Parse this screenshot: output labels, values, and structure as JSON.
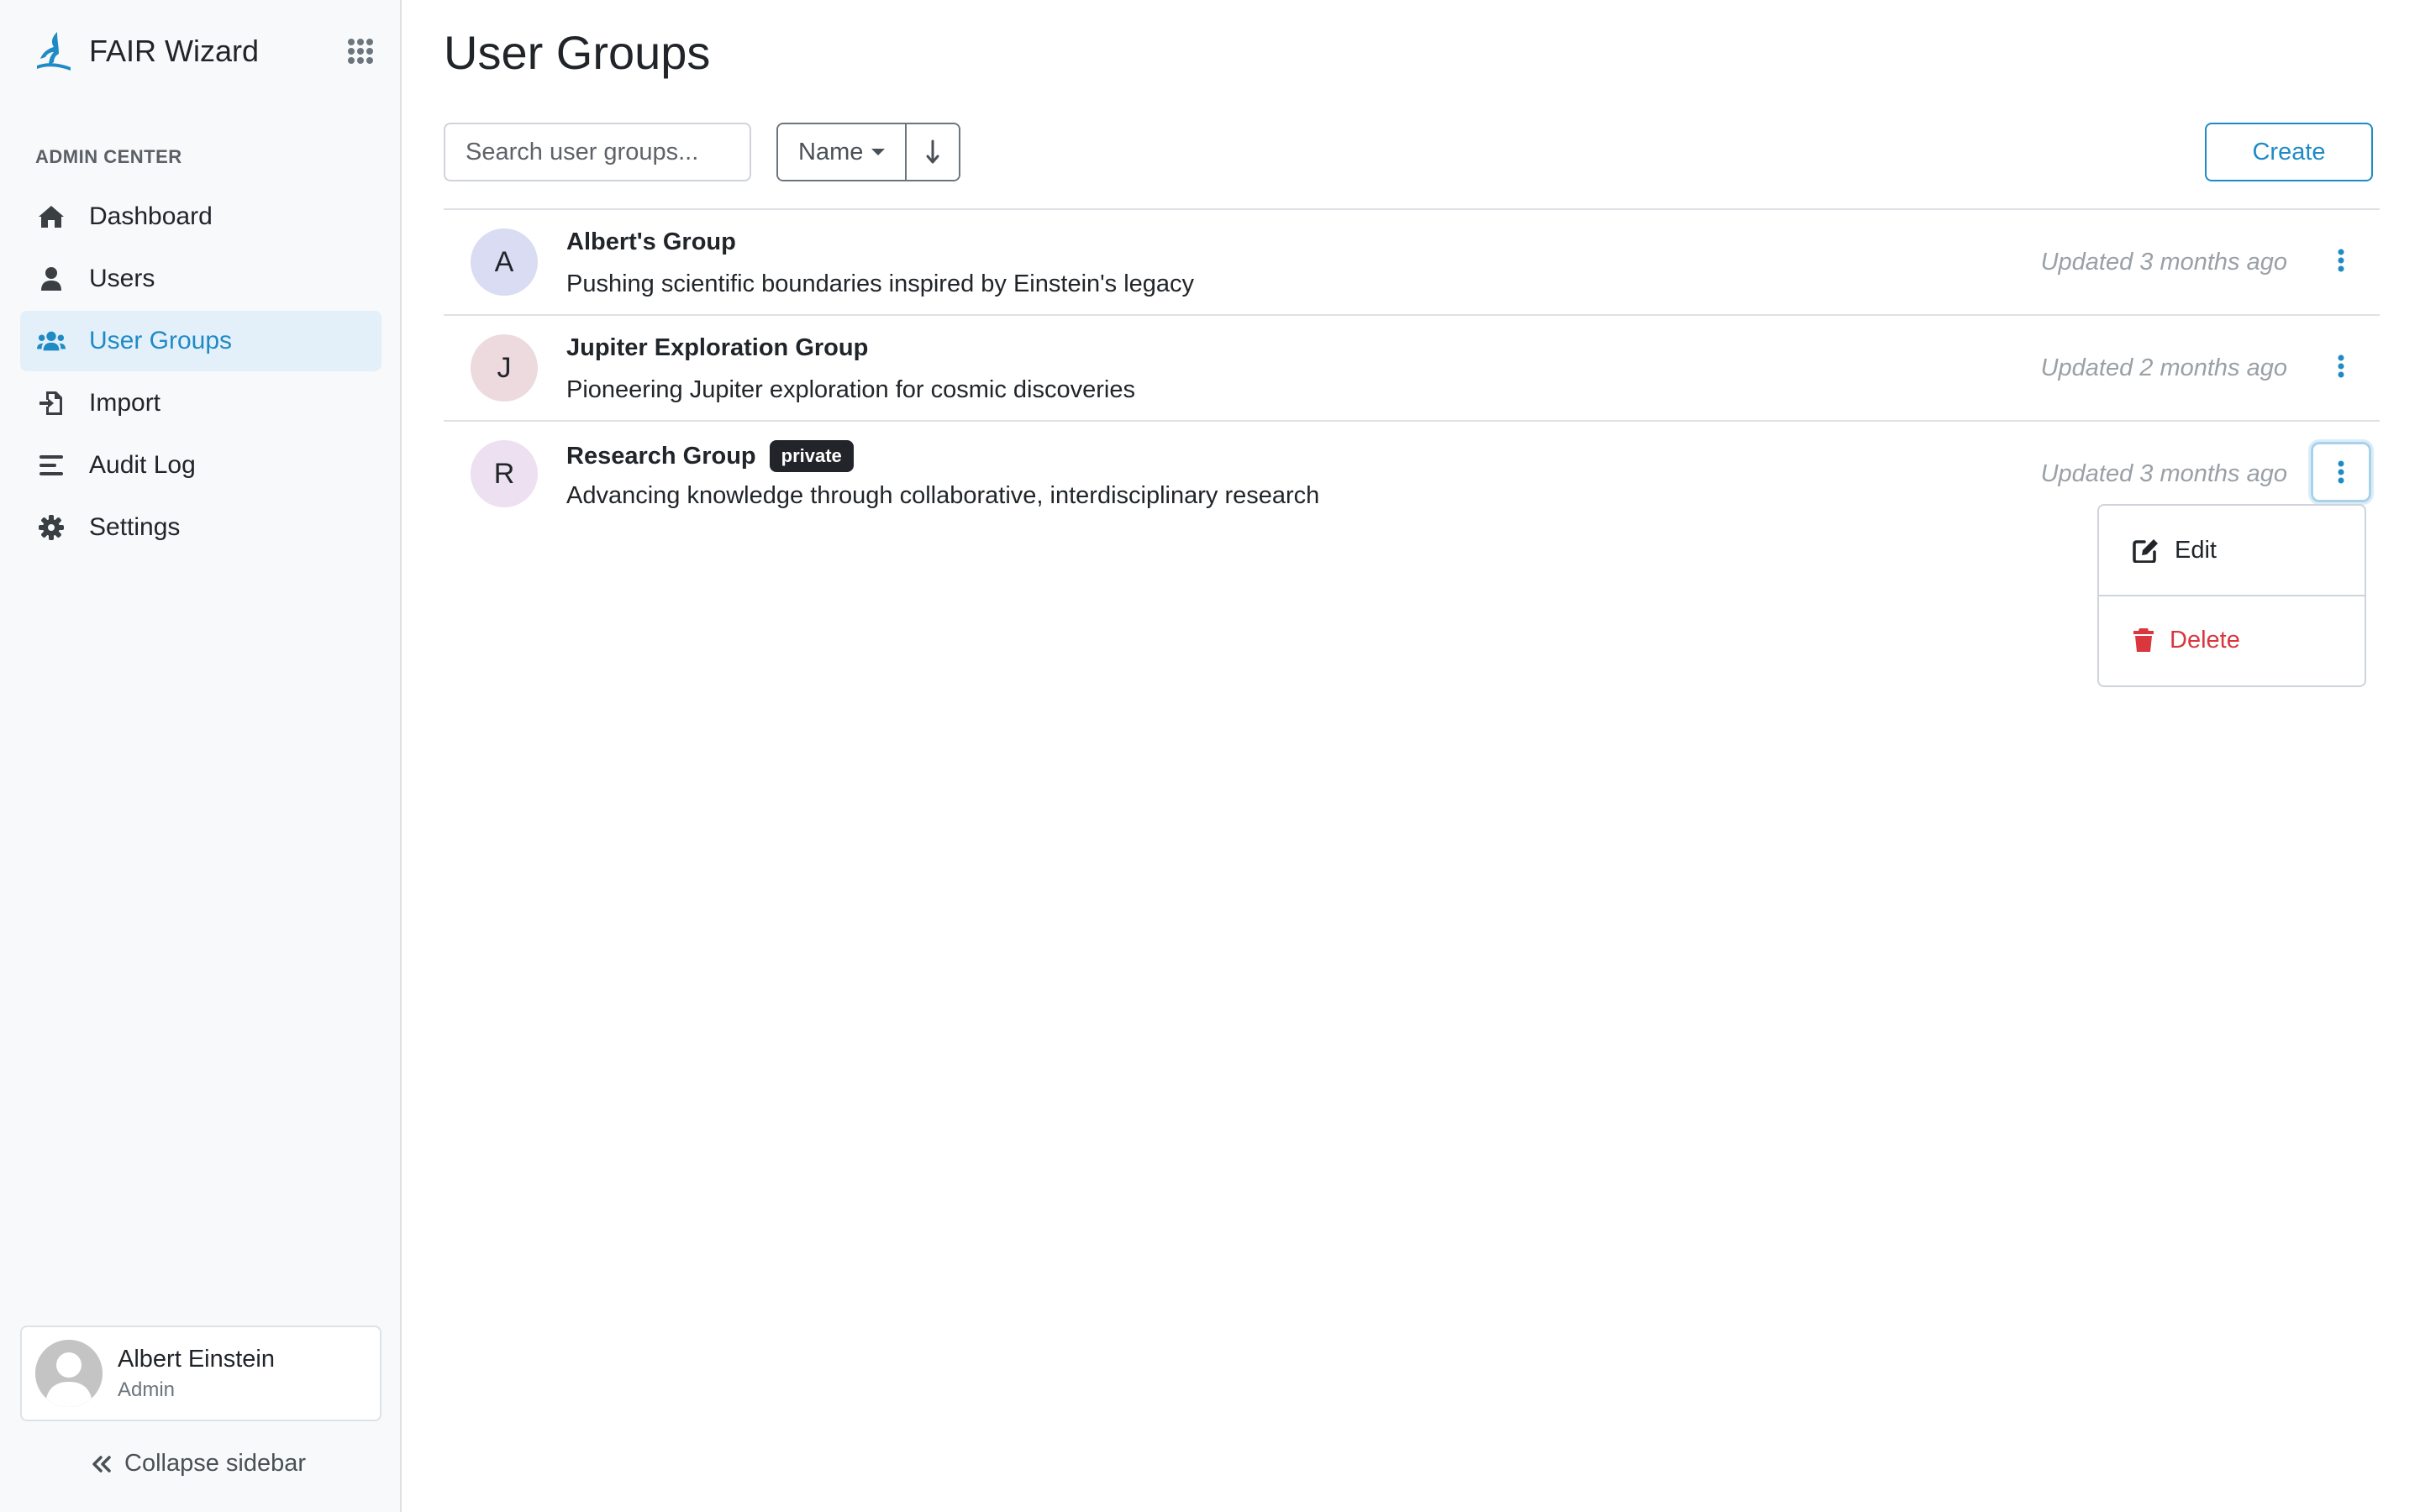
{
  "app": {
    "name": "FAIR Wizard"
  },
  "sidebar": {
    "section_title": "ADMIN CENTER",
    "items": [
      {
        "label": "Dashboard",
        "icon": "home-icon"
      },
      {
        "label": "Users",
        "icon": "user-icon"
      },
      {
        "label": "User Groups",
        "icon": "users-icon",
        "active": true
      },
      {
        "label": "Import",
        "icon": "import-icon"
      },
      {
        "label": "Audit Log",
        "icon": "list-icon"
      },
      {
        "label": "Settings",
        "icon": "gear-icon"
      }
    ],
    "profile": {
      "name": "Albert Einstein",
      "role": "Admin"
    },
    "collapse_label": "Collapse sidebar"
  },
  "main": {
    "title": "User Groups",
    "search_placeholder": "Search user groups...",
    "sort_label": "Name",
    "sort_direction": "descending",
    "create_label": "Create",
    "groups": [
      {
        "initial": "A",
        "name": "Albert's Group",
        "description": "Pushing scientific boundaries inspired by Einstein's legacy",
        "updated": "Updated 3 months ago",
        "badge": "",
        "avatar_color": "#d9dcf2"
      },
      {
        "initial": "J",
        "name": "Jupiter Exploration Group",
        "description": "Pioneering Jupiter exploration for cosmic discoveries",
        "updated": "Updated 2 months ago",
        "badge": "",
        "avatar_color": "#eddadf"
      },
      {
        "initial": "R",
        "name": "Research Group",
        "description": "Advancing knowledge through collaborative, interdisciplinary research",
        "updated": "Updated 3 months ago",
        "badge": "private",
        "avatar_color": "#ece0f1"
      }
    ],
    "dropdown": {
      "edit_label": "Edit",
      "delete_label": "Delete"
    }
  },
  "colors": {
    "accent": "#1f8bc6",
    "danger": "#d9363e",
    "active_bg": "#e4f0f9"
  }
}
